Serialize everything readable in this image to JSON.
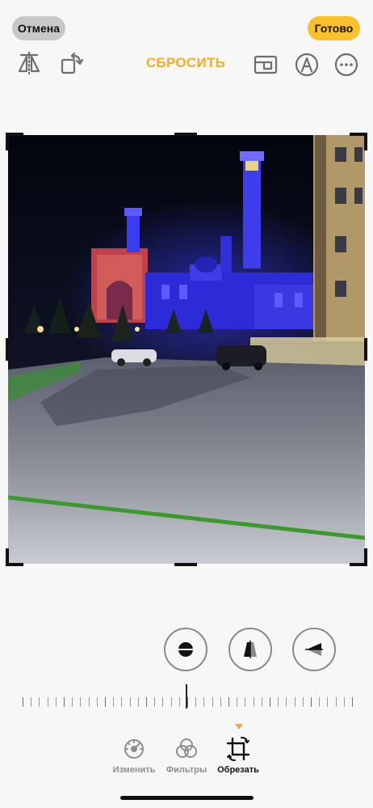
{
  "header": {
    "cancel_label": "Отмена",
    "done_label": "Готово",
    "reset_label": "СБРОСИТЬ"
  },
  "toolbar_icons": [
    "flip-horizontal-icon",
    "rotate-icon",
    "aspect-ratio-icon",
    "markup-pen-icon",
    "more-icon"
  ],
  "adjust_modes": [
    "straighten-icon",
    "vertical-perspective-icon",
    "horizontal-perspective-icon"
  ],
  "bottom_tabs": [
    {
      "label": "Изменить",
      "icon": "adjust-dial-icon",
      "active": false
    },
    {
      "label": "Фильтры",
      "icon": "filters-icon",
      "active": false
    },
    {
      "label": "Обрезать",
      "icon": "crop-rotate-icon",
      "active": true
    }
  ],
  "colors": {
    "accent": "#f5ad24",
    "done_bg": "#fac12c",
    "cancel_bg": "#c8c8ca",
    "background": "#f7f7f8"
  }
}
